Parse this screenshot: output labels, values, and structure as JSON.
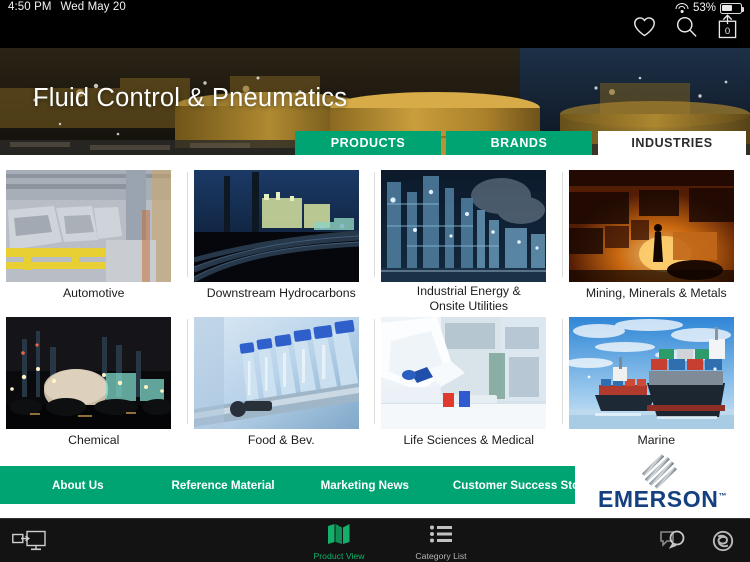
{
  "status_bar": {
    "time": "4:50 PM",
    "date": "Wed May 20",
    "wifi_icon": "wifi-icon",
    "battery_percent": "53%",
    "battery_icon": "battery-icon"
  },
  "top_actions": {
    "favorites_icon": "heart-icon",
    "search_icon": "search-icon",
    "cart_icon": "cart-upload-icon",
    "cart_count": "0"
  },
  "hero": {
    "title": "Fluid Control & Pneumatics",
    "image_alt": "oil-storage-tanks-night"
  },
  "tabs": [
    {
      "label": "PRODUCTS",
      "active": false
    },
    {
      "label": "BRANDS",
      "active": false
    },
    {
      "label": "INDUSTRIES",
      "active": true
    }
  ],
  "industries": [
    {
      "label": "Automotive",
      "image_alt": "automotive-assembly-line"
    },
    {
      "label": "Downstream Hydrocarbons",
      "image_alt": "refinery-pipelines-night"
    },
    {
      "label": "Industrial Energy &\nOnsite Utilities",
      "image_alt": "industrial-energy-plant"
    },
    {
      "label": "Mining, Minerals & Metals",
      "image_alt": "molten-metal-foundry"
    },
    {
      "label": "Chemical",
      "image_alt": "chemical-plant-night"
    },
    {
      "label": "Food & Bev.",
      "image_alt": "bottling-line-blue-bottles"
    },
    {
      "label": "Life Sciences & Medical",
      "image_alt": "lab-technician-vials"
    },
    {
      "label": "Marine",
      "image_alt": "container-ships-at-sea"
    }
  ],
  "footer_nav": [
    {
      "label": "About Us"
    },
    {
      "label": "Reference Material"
    },
    {
      "label": "Marketing News"
    },
    {
      "label": "Customer Success Stories"
    }
  ],
  "brand": {
    "name": "EMERSON",
    "trademark": "™",
    "logo_icon": "emerson-diamond-logo"
  },
  "toolbar": {
    "cast_icon": "cast-screen-icon",
    "product_view": {
      "label": "Product View",
      "icon": "map-fold-icon",
      "active": true
    },
    "category_list": {
      "label": "Category List",
      "icon": "bullet-list-icon",
      "active": false
    },
    "feedback_icon": "chat-bubbles-icon",
    "link_icon": "knot-link-icon"
  },
  "colors": {
    "brand_green": "#00a473",
    "brand_blue": "#14407f",
    "accent_green": "#12b06b",
    "bar_black": "#000000"
  }
}
